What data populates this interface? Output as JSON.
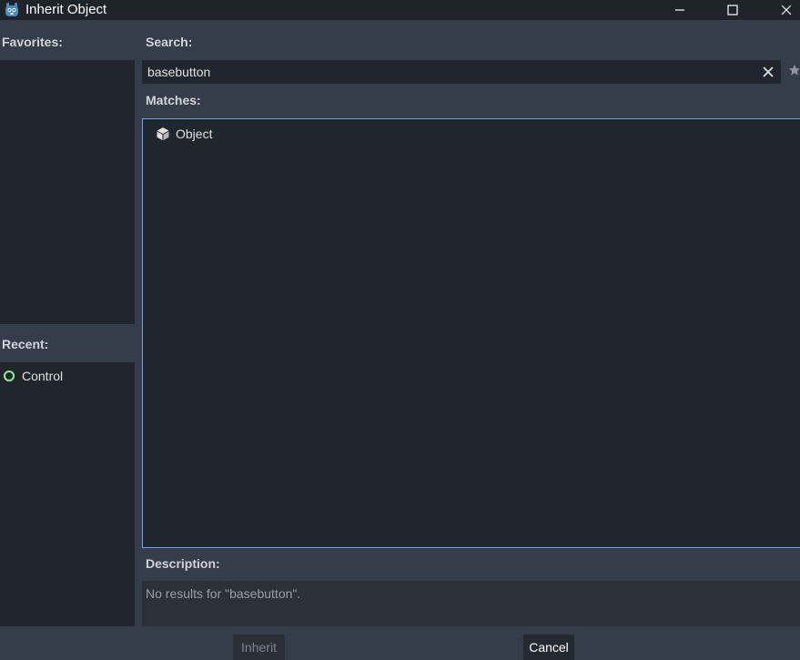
{
  "window": {
    "title": "Inherit Object",
    "controls": {
      "minimize": "—",
      "maximize": "☐",
      "close": "✕"
    }
  },
  "favorites": {
    "label": "Favorites:",
    "items": []
  },
  "recent": {
    "label": "Recent:",
    "items": [
      {
        "label": "Control",
        "icon": "control-circle-icon",
        "color": "#8eef97"
      }
    ]
  },
  "search": {
    "label": "Search:",
    "value": "basebutton",
    "placeholder": ""
  },
  "matches": {
    "label": "Matches:",
    "items": [
      {
        "label": "Object",
        "icon": "object-cube-icon"
      }
    ]
  },
  "description": {
    "label": "Description:",
    "text": "No results for \"basebutton\"."
  },
  "buttons": {
    "inherit": "Inherit",
    "cancel": "Cancel"
  },
  "colors": {
    "accent": "#6ca9ec",
    "panel": "#21252d",
    "background": "#363d4a",
    "titlebar": "#1f232a"
  }
}
